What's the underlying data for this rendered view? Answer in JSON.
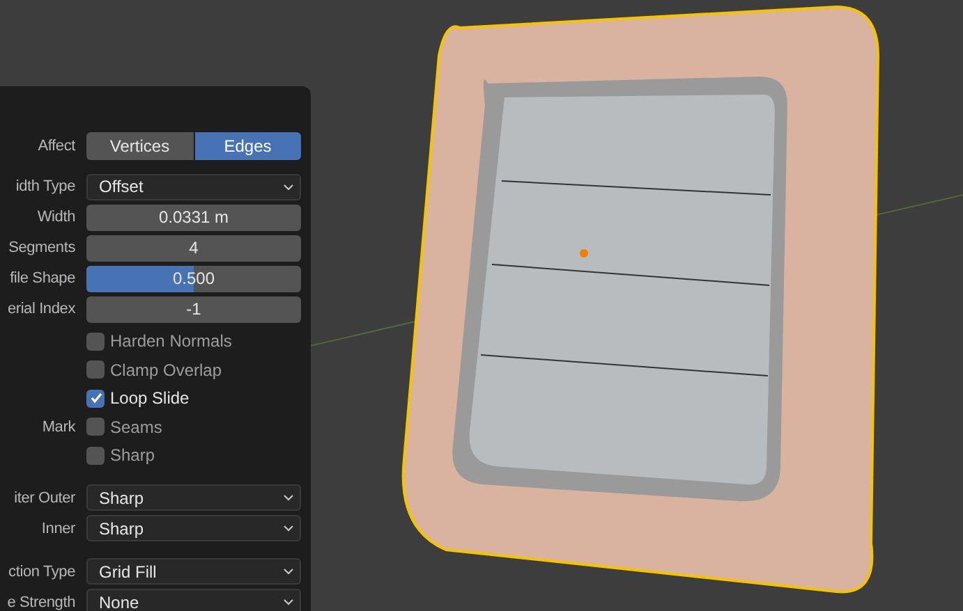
{
  "panel": {
    "affect": {
      "label": "Affect",
      "options": [
        {
          "label": "Vertices",
          "selected": false
        },
        {
          "label": "Edges",
          "selected": true
        }
      ]
    },
    "rows": [
      {
        "kind": "dropdown",
        "label": "idth Type",
        "value": "Offset"
      },
      {
        "kind": "number",
        "label": "Width",
        "value": "0.0331 m"
      },
      {
        "kind": "number",
        "label": "Segments",
        "value": "4"
      },
      {
        "kind": "slider",
        "label": "file Shape",
        "value": "0.500",
        "level": 0.5
      },
      {
        "kind": "number",
        "label": "erial Index",
        "value": "-1"
      }
    ],
    "checks": [
      {
        "label": "Harden Normals",
        "checked": false
      },
      {
        "label": "Clamp Overlap",
        "checked": false
      },
      {
        "label": "Loop Slide",
        "checked": true
      },
      {
        "group": "Mark",
        "label": "Seams",
        "checked": false
      },
      {
        "label": "Sharp",
        "checked": false
      }
    ],
    "miter": [
      {
        "label": "iter Outer",
        "value": "Sharp"
      },
      {
        "label": "Inner",
        "value": "Sharp"
      }
    ],
    "section": [
      {
        "label": "ction Type",
        "value": "Grid Fill"
      },
      {
        "label": "e Strength",
        "value": "None"
      }
    ]
  }
}
